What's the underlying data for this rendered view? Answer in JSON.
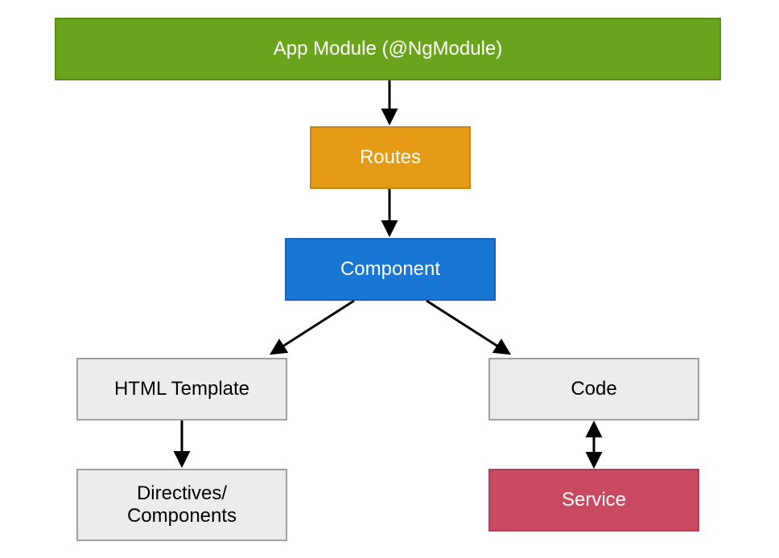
{
  "nodes": {
    "app_module": {
      "label": "App Module (@NgModule)"
    },
    "routes": {
      "label": "Routes"
    },
    "component": {
      "label": "Component"
    },
    "html_template": {
      "label": "HTML Template"
    },
    "code": {
      "label": "Code"
    },
    "directives": {
      "label": "Directives/\nComponents"
    },
    "service": {
      "label": "Service"
    }
  },
  "edges": [
    {
      "from": "app_module",
      "to": "routes",
      "type": "single"
    },
    {
      "from": "routes",
      "to": "component",
      "type": "single"
    },
    {
      "from": "component",
      "to": "html_template",
      "type": "single"
    },
    {
      "from": "component",
      "to": "code",
      "type": "single"
    },
    {
      "from": "html_template",
      "to": "directives",
      "type": "single"
    },
    {
      "from": "code",
      "to": "service",
      "type": "double"
    }
  ]
}
